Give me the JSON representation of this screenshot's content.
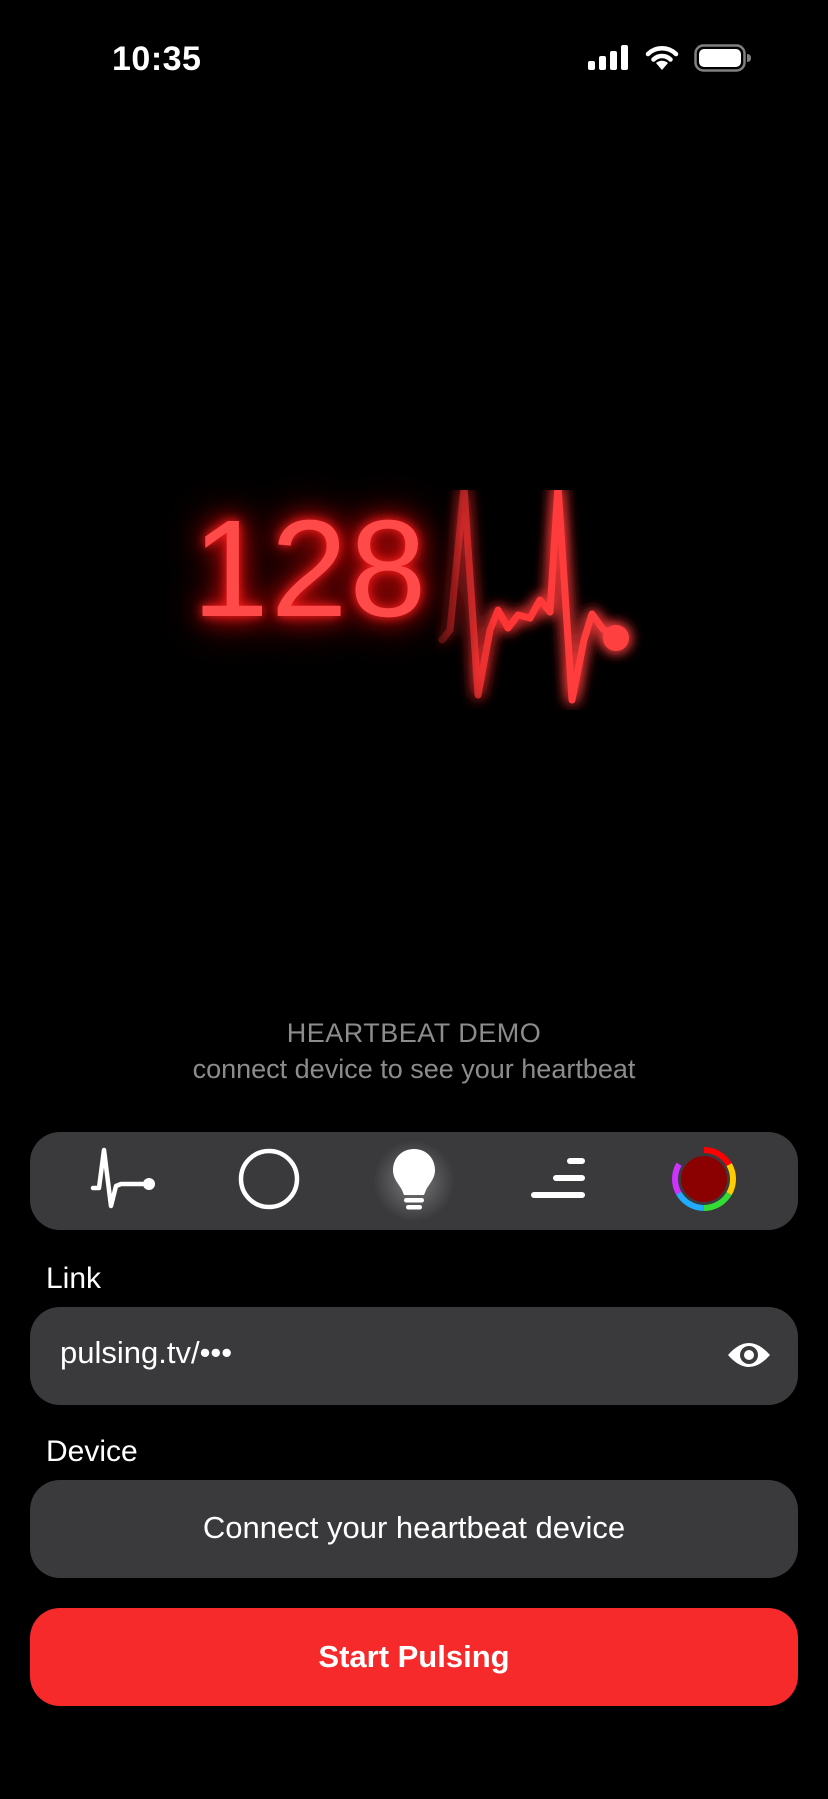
{
  "status_bar": {
    "time": "10:35",
    "icons": [
      "cellular-signal-icon",
      "wifi-icon",
      "battery-icon"
    ]
  },
  "hero": {
    "bpm": "128",
    "glow_color": "#ff2a2a"
  },
  "demo": {
    "title": "HEARTBEAT DEMO",
    "subtitle": "connect device to see your heartbeat"
  },
  "modes": [
    {
      "icon": "heartbeat-line-icon",
      "selected": false
    },
    {
      "icon": "circle-outline-icon",
      "selected": false
    },
    {
      "icon": "lightbulb-icon",
      "selected": true
    },
    {
      "icon": "text-align-lines-icon",
      "selected": false
    },
    {
      "icon": "color-wheel-icon",
      "selected": false,
      "color": "#8b0000"
    }
  ],
  "link": {
    "label": "Link",
    "value": "pulsing.tv/•••"
  },
  "device": {
    "label": "Device",
    "button_label": "Connect your heartbeat device"
  },
  "start": {
    "label": "Start Pulsing",
    "color": "#f62a2b"
  }
}
